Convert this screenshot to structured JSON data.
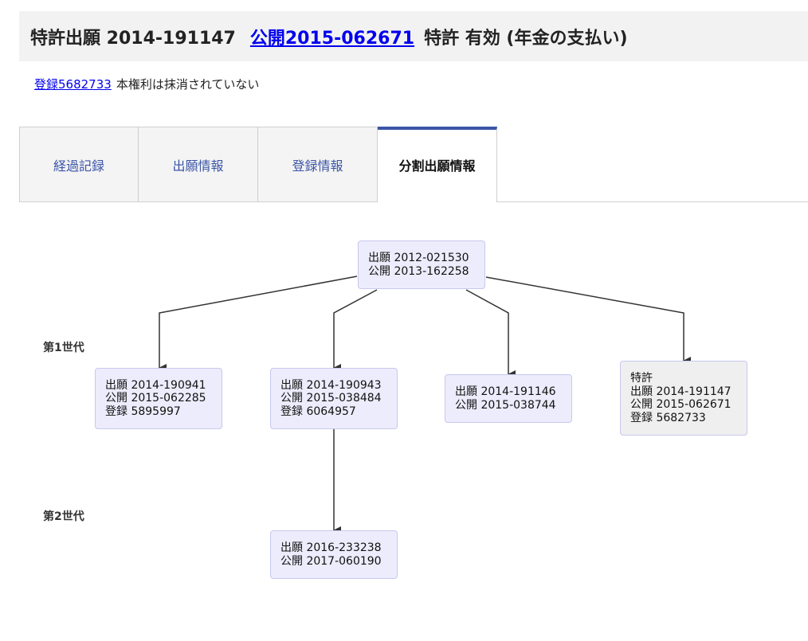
{
  "header": {
    "app_no": "特許出願 2014-191147",
    "pub_link": "公開2015-062671",
    "status": "特許 有効 (年金の支払い)"
  },
  "registration": {
    "link": "登録5682733",
    "status": "本権利は抹消されていない"
  },
  "tabs": [
    {
      "label": "経過記録"
    },
    {
      "label": "出願情報"
    },
    {
      "label": "登録情報"
    },
    {
      "label": "分割出願情報",
      "active": true
    }
  ],
  "generations": {
    "gen1": "第1世代",
    "gen2": "第2世代"
  },
  "nodes": {
    "root": {
      "app": "出願 2012-021530",
      "pub": "公開 2013-162258"
    },
    "g1a": {
      "app": "出願 2014-190941",
      "pub": "公開 2015-062285",
      "reg": "登録 5895997"
    },
    "g1b": {
      "app": "出願 2014-190943",
      "pub": "公開 2015-038484",
      "reg": "登録 6064957"
    },
    "g1c": {
      "app": "出願 2014-191146",
      "pub": "公開 2015-038744"
    },
    "g1d": {
      "kind": "特許",
      "app": "出願 2014-191147",
      "pub": "公開 2015-062671",
      "reg": "登録 5682733"
    },
    "g2a": {
      "app": "出願 2016-233238",
      "pub": "公開 2017-060190"
    }
  },
  "colors": {
    "tab_accent": "#3b55a6",
    "link": "#0000ee",
    "node_bg": "#ececfc",
    "node_current_bg": "#efefef"
  }
}
